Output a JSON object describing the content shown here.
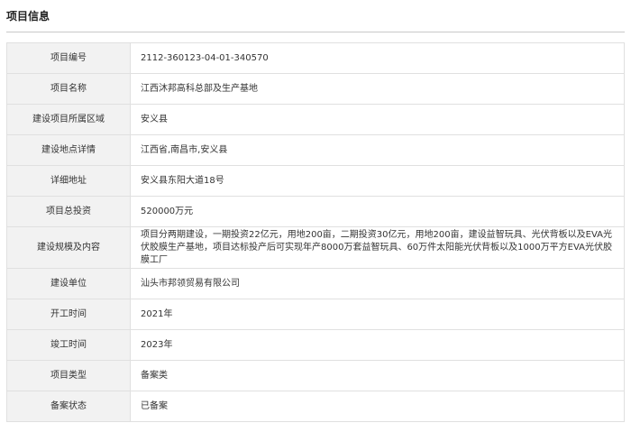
{
  "section": {
    "title": "项目信息"
  },
  "rows": [
    {
      "label": "项目编号",
      "value": "2112-360123-04-01-340570"
    },
    {
      "label": "项目名称",
      "value": "江西沐邦高科总部及生产基地"
    },
    {
      "label": "建设项目所属区域",
      "value": "安义县"
    },
    {
      "label": "建设地点详情",
      "value": "江西省,南昌市,安义县"
    },
    {
      "label": "详细地址",
      "value": "安义县东阳大道18号"
    },
    {
      "label": "项目总投资",
      "value": "520000万元"
    },
    {
      "label": "建设规模及内容",
      "value": "项目分两期建设，一期投资22亿元，用地200亩，二期投资30亿元，用地200亩，建设益智玩具、光伏背板以及EVA光伏胶膜生产基地，项目达标投产后可实现年产8000万套益智玩具、60万件太阳能光伏背板以及1000万平方EVA光伏胶膜工厂"
    },
    {
      "label": "建设单位",
      "value": "汕头市邦领贸易有限公司"
    },
    {
      "label": "开工时间",
      "value": "2021年"
    },
    {
      "label": "竣工时间",
      "value": "2023年"
    },
    {
      "label": "项目类型",
      "value": "备案类"
    },
    {
      "label": "备案状态",
      "value": "已备案"
    }
  ]
}
